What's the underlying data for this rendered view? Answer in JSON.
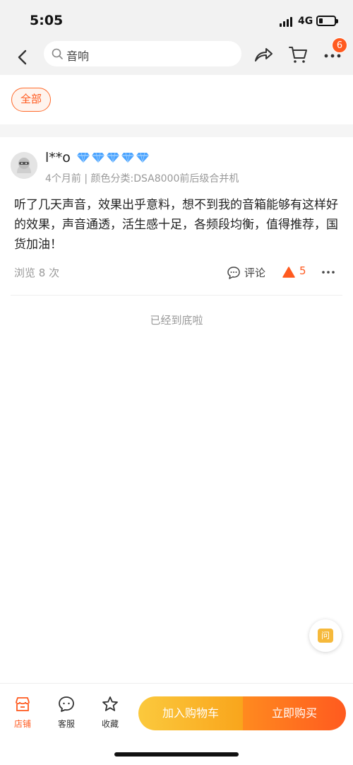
{
  "status_bar": {
    "time": "5:05",
    "network": "4G"
  },
  "nav": {
    "search_text": "音响",
    "more_badge": "6",
    "icons": [
      "chevron-left-icon",
      "search-icon",
      "share-icon",
      "cart-icon",
      "more-icon"
    ]
  },
  "filter": {
    "chip_label": "全部"
  },
  "review": {
    "user_name": "l**o",
    "level_gems": 5,
    "meta": "4个月前 | 颜色分类:DSA8000前后级合并机",
    "content": "听了几天声音，效果出乎意料，想不到我的音箱能够有这样好的效果，声音通透，活生感十足，各频段均衡，值得推荐，国货加油！",
    "views": "浏览 8 次",
    "comment_label": "评论",
    "like_count": "5"
  },
  "end_text": "已经到底啦",
  "fab": {
    "label": "问"
  },
  "bottom_bar": {
    "store_label": "店铺",
    "service_label": "客服",
    "favorite_label": "收藏",
    "add_to_cart_label": "加入购物车",
    "buy_now_label": "立即购买"
  },
  "colors": {
    "accent": "#ff5a1f",
    "cart_gradient_start": "#fbc93d",
    "cart_gradient_end": "#f9a51c",
    "buy_gradient_start": "#ff8a1f",
    "buy_gradient_end": "#ff5a1f",
    "gem": "#4aa3ff"
  }
}
